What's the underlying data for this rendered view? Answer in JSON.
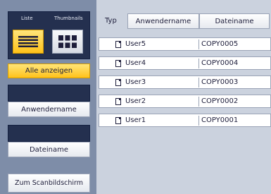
{
  "view": {
    "list_label": "Liste",
    "thumbnails_label": "Thumbnails"
  },
  "filters": {
    "show_all": "Alle anzeigen",
    "user_name": "Anwendername",
    "file_name": "Dateiname",
    "to_scan_screen": "Zum Scanbildschirm"
  },
  "table": {
    "type_label": "Typ",
    "columns": [
      "Anwendername",
      "Dateiname"
    ],
    "rows": [
      {
        "type_icon": "document-icon",
        "user": "User5",
        "file": "COPY0005"
      },
      {
        "type_icon": "document-icon",
        "user": "User4",
        "file": "COPY0004"
      },
      {
        "type_icon": "document-icon",
        "user": "User3",
        "file": "COPY0003"
      },
      {
        "type_icon": "document-icon",
        "user": "User2",
        "file": "COPY0002"
      },
      {
        "type_icon": "document-icon",
        "user": "User1",
        "file": "COPY0001"
      }
    ]
  },
  "colors": {
    "accent": "#ffc21a",
    "panel": "#7e8da8",
    "dark": "#24304f"
  }
}
